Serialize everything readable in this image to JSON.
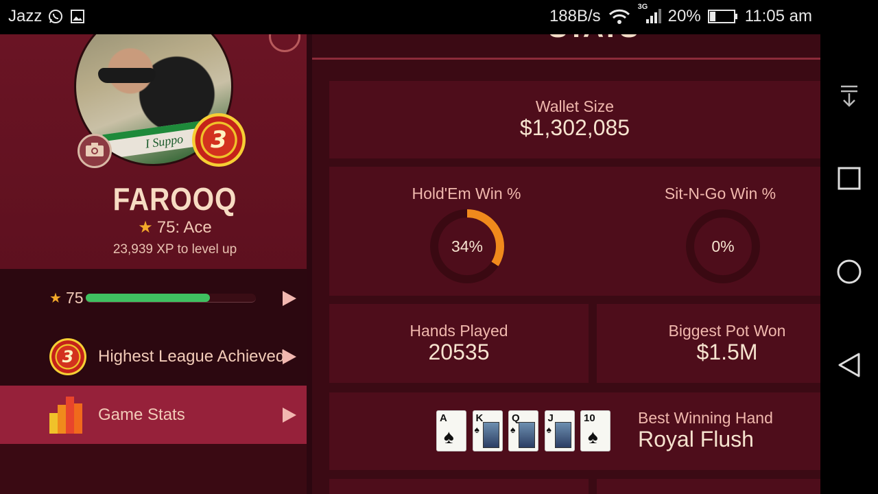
{
  "status_bar": {
    "carrier": "Jazz",
    "network_speed": "188B/s",
    "network_type": "3G",
    "battery": "20%",
    "time": "11:05 am"
  },
  "profile": {
    "name": "FAROOQ",
    "level_text": "75: Ace",
    "xp_to_level": "23,939 XP to level up",
    "league_badge": "3"
  },
  "menu": {
    "xp_row": {
      "level": "75",
      "progress_fraction": 0.73
    },
    "items": [
      {
        "label": "Highest League Achieved",
        "badge": "3"
      },
      {
        "label": "Game Stats"
      }
    ]
  },
  "stats": {
    "title": "STATS",
    "wallet": {
      "label": "Wallet Size",
      "value": "$1,302,085"
    },
    "holdem": {
      "label": "Hold'Em Win %",
      "value": "34%",
      "percent": 34
    },
    "sitngo": {
      "label": "Sit-N-Go Win %",
      "value": "0%",
      "percent": 0
    },
    "hands_played": {
      "label": "Hands Played",
      "value": "20535"
    },
    "biggest_pot": {
      "label": "Biggest Pot Won",
      "value": "$1.5M"
    },
    "best_hand": {
      "label": "Best Winning Hand",
      "value": "Royal Flush",
      "cards": [
        "A",
        "K",
        "Q",
        "J",
        "10"
      ],
      "suit": "♠"
    }
  },
  "colors": {
    "accent_orange": "#f08a1c",
    "xp_green": "#3fc160",
    "active_menu": "#96213a"
  }
}
